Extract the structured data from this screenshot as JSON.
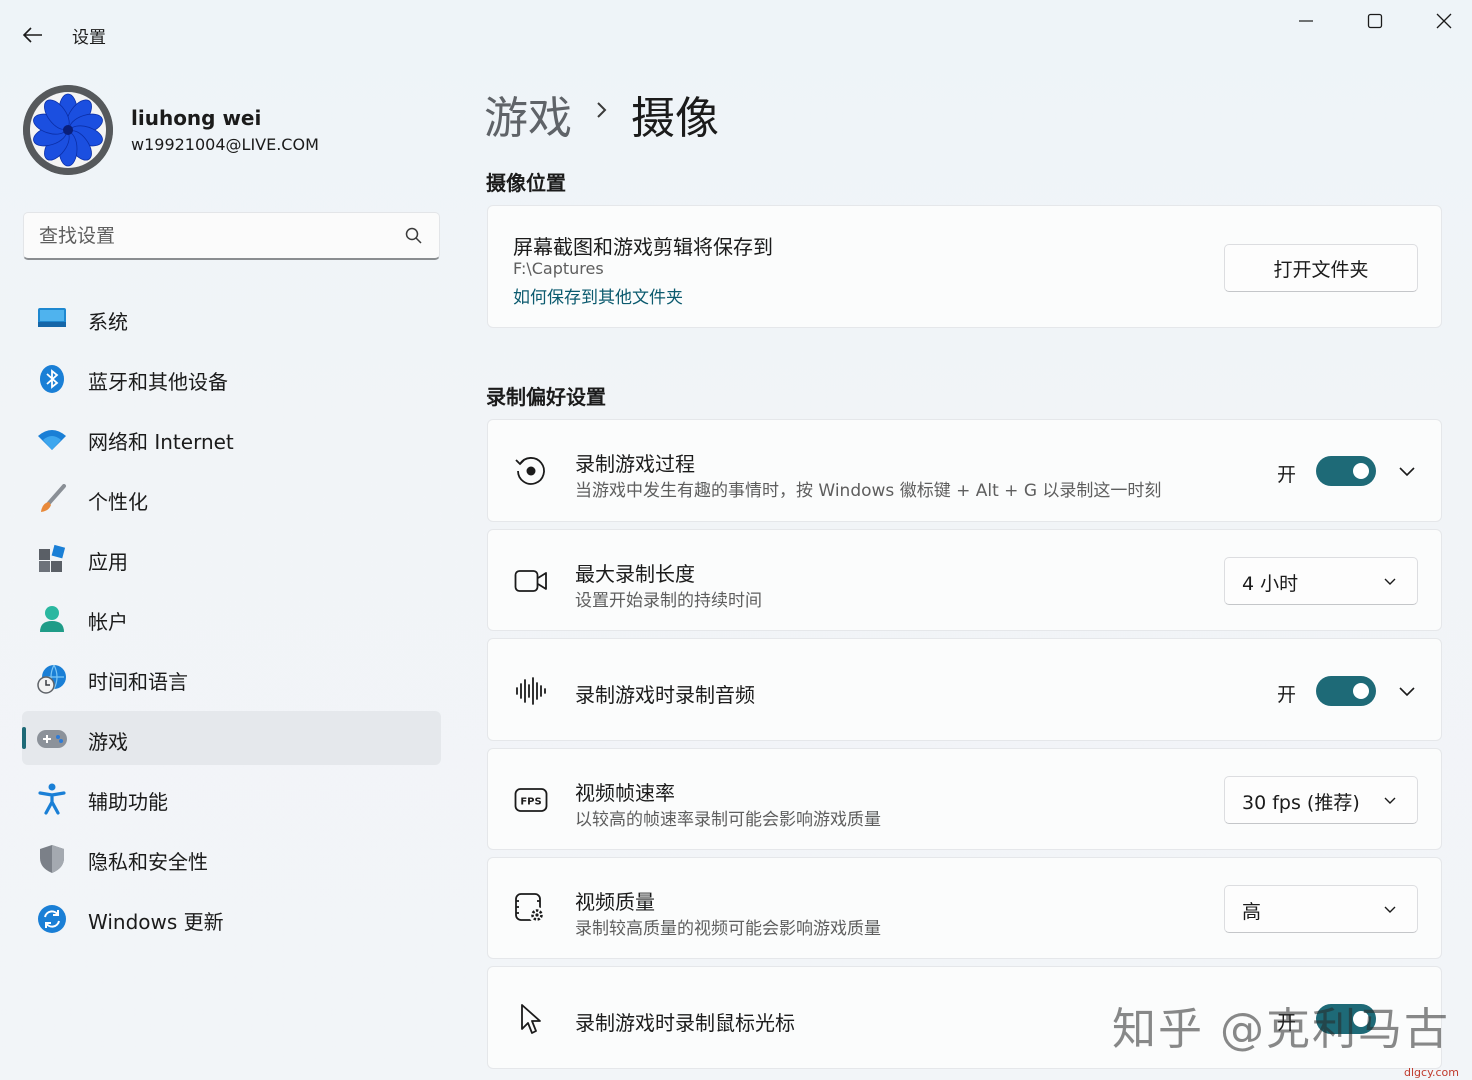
{
  "window": {
    "title": "设置",
    "controls": {
      "minimize": "minimize-icon",
      "maximize": "maximize-icon",
      "close": "close-icon"
    }
  },
  "profile": {
    "name": "liuhong wei",
    "email": "w19921004@LIVE.COM"
  },
  "search": {
    "placeholder": "查找设置",
    "value": ""
  },
  "sidebar": {
    "items": [
      {
        "label": "系统",
        "icon": "system-monitor-icon",
        "active": false
      },
      {
        "label": "蓝牙和其他设备",
        "icon": "bluetooth-icon",
        "active": false
      },
      {
        "label": "网络和 Internet",
        "icon": "wifi-icon",
        "active": false
      },
      {
        "label": "个性化",
        "icon": "paintbrush-icon",
        "active": false
      },
      {
        "label": "应用",
        "icon": "apps-icon",
        "active": false
      },
      {
        "label": "帐户",
        "icon": "account-icon",
        "active": false
      },
      {
        "label": "时间和语言",
        "icon": "time-language-icon",
        "active": false
      },
      {
        "label": "游戏",
        "icon": "gamepad-icon",
        "active": true
      },
      {
        "label": "辅助功能",
        "icon": "accessibility-icon",
        "active": false
      },
      {
        "label": "隐私和安全性",
        "icon": "shield-icon",
        "active": false
      },
      {
        "label": "Windows 更新",
        "icon": "windows-update-icon",
        "active": false
      }
    ]
  },
  "breadcrumb": {
    "parent": "游戏",
    "current": "摄像"
  },
  "sections": {
    "location": {
      "title": "摄像位置",
      "card": {
        "title": "屏幕截图和游戏剪辑将保存到",
        "path": "F:\\Captures",
        "link": "如何保存到其他文件夹",
        "button": "打开文件夹"
      }
    },
    "recording": {
      "title": "录制偏好设置",
      "record_game": {
        "title": "录制游戏过程",
        "description": "当游戏中发生有趣的事情时，按 Windows 徽标键 + Alt + G 以录制这一时刻",
        "state_label": "开",
        "on": true
      },
      "max_length": {
        "title": "最大录制长度",
        "description": "设置开始录制的持续时间",
        "value": "4 小时"
      },
      "record_audio": {
        "title": "录制游戏时录制音频",
        "state_label": "开",
        "on": true
      },
      "frame_rate": {
        "title": "视频帧速率",
        "description": "以较高的帧速率录制可能会影响游戏质量",
        "value": "30 fps (推荐)",
        "icon_text": "FPS"
      },
      "video_quality": {
        "title": "视频质量",
        "description": "录制较高质量的视频可能会影响游戏质量",
        "value": "高"
      },
      "record_cursor": {
        "title": "录制游戏时录制鼠标光标",
        "state_label": "开",
        "on": true
      }
    }
  },
  "watermark": {
    "text": "知乎 @克利马古",
    "site": "dlgcy.com"
  },
  "colors": {
    "accent": "#1e6a77",
    "link": "#0b5a6e"
  }
}
